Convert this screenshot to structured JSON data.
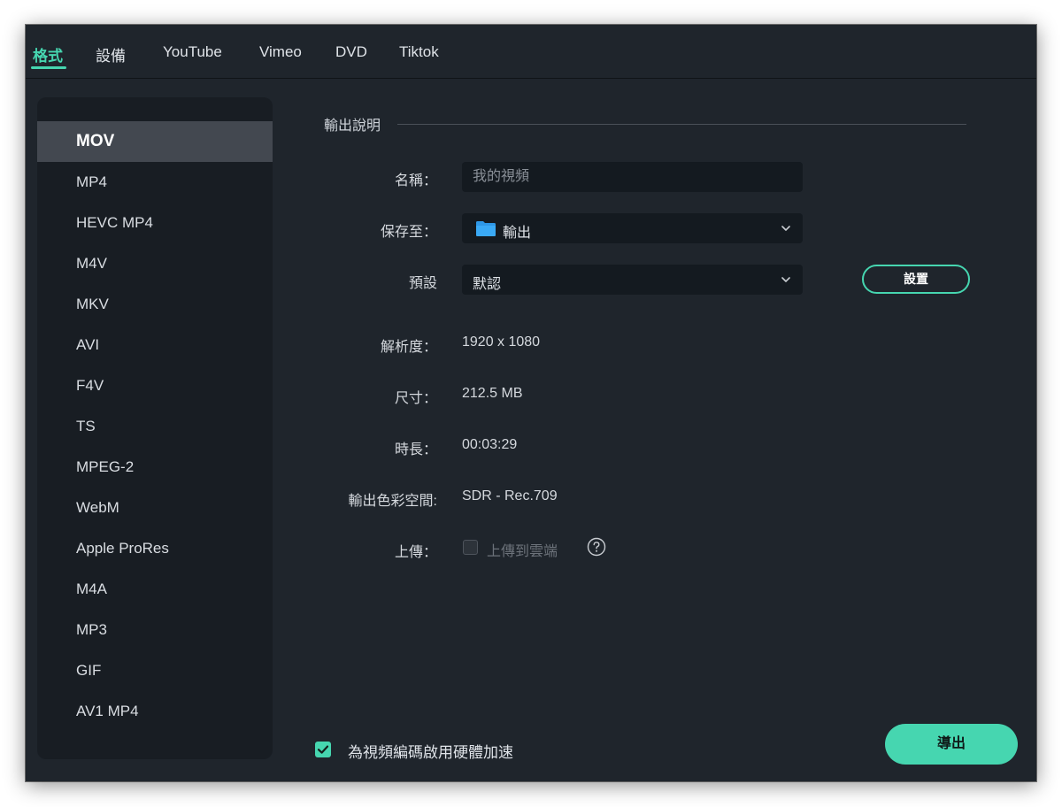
{
  "tabs": [
    "格式",
    "設備",
    "YouTube",
    "Vimeo",
    "DVD",
    "Tiktok"
  ],
  "active_tab": "格式",
  "formats": [
    "MOV",
    "MP4",
    "HEVC MP4",
    "M4V",
    "MKV",
    "AVI",
    "F4V",
    "TS",
    "MPEG-2",
    "WebM",
    "Apple ProRes",
    "M4A",
    "MP3",
    "GIF",
    "AV1 MP4"
  ],
  "selected_format": "MOV",
  "section_title": "輸出說明",
  "name_field": {
    "label": "名稱：",
    "value": "",
    "placeholder": "我的視頻"
  },
  "save_to": {
    "label": "保存至：",
    "value": "輸出",
    "icon": "folder-icon"
  },
  "preset": {
    "label": "預設",
    "value": "默認"
  },
  "settings_button": "設置",
  "info": {
    "resolution": {
      "label": "解析度：",
      "value": "1920 x 1080"
    },
    "size": {
      "label": "尺寸：",
      "value": "212.5 MB"
    },
    "duration": {
      "label": "時長：",
      "value": "00:03:29"
    },
    "color_space": {
      "label": "輸出色彩空間:",
      "value": "SDR - Rec.709"
    }
  },
  "upload": {
    "label": "上傳：",
    "checkbox_label": "上傳到雲端",
    "checked": false,
    "enabled": false,
    "help_icon": "question-circle-icon"
  },
  "hw_accel": {
    "label": "為視頻編碼啟用硬體加速",
    "checked": true
  },
  "export_button": "導出",
  "colors": {
    "accent": "#46d6b0",
    "window_bg": "#1f252c",
    "sidebar_bg": "#181d23",
    "selected_item_bg": "#434850"
  }
}
